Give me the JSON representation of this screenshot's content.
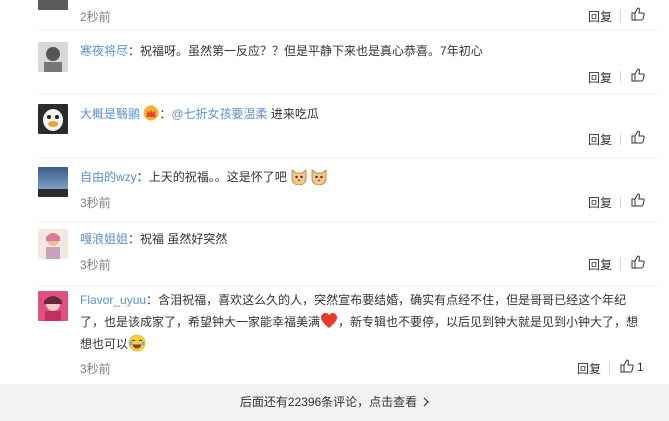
{
  "comments": [
    {
      "time": "2秒前",
      "reply_label": "回复",
      "like_count": ""
    },
    {
      "username": "寒夜将尽",
      "text": "祝福呀。虽然第一反应？？但是平静下来也是真心恭喜。7年初心",
      "time": "",
      "reply_label": "回复",
      "like_count": ""
    },
    {
      "username": "大概是翳鹂",
      "mention": "@七折女孩要温柔",
      "text": "进来吃瓜",
      "time": "",
      "reply_label": "回复",
      "like_count": ""
    },
    {
      "username": "自由的wzy",
      "text": "上天的祝福。。这是怀了吧",
      "time": "3秒前",
      "reply_label": "回复",
      "like_count": ""
    },
    {
      "username": "嘎浪姐姐",
      "text": "祝福 虽然好突然",
      "time": "3秒前",
      "reply_label": "回复",
      "like_count": ""
    },
    {
      "username": "Flavor_uyuu",
      "text_part1": "含泪祝福，喜欢这么久的人，突然宣布要结婚，确实有点经不住，但是哥哥已经这个年纪了，也是该成家了，希望钟大一家能幸福美满",
      "text_part2": "，新专辑也不要停，以后见到钟大就是见到小钟大了，想想也可以",
      "time": "3秒前",
      "reply_label": "回复",
      "like_count": "1"
    }
  ],
  "colon": "：",
  "more": {
    "label": "后面还有22396条评论，点击查看"
  },
  "colors": {
    "username": "#eb7350",
    "mention": "#5b8fd3",
    "more_bar_bg": "#f2f2f5"
  }
}
